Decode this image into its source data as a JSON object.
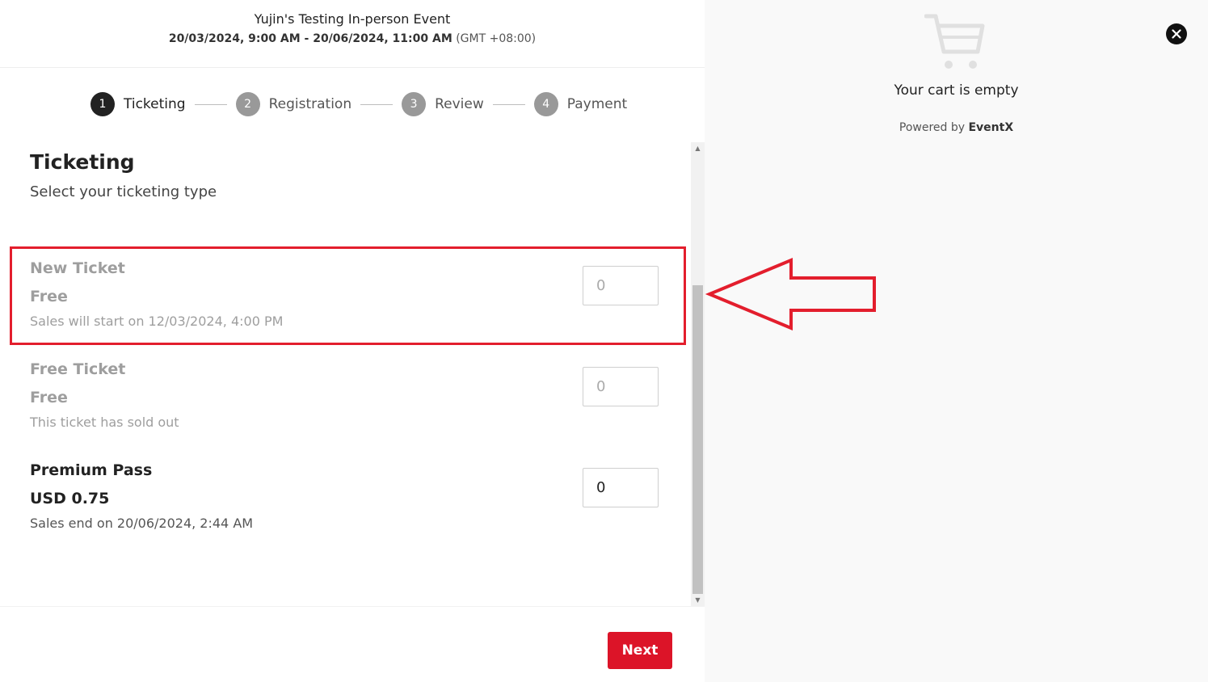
{
  "event": {
    "title": "Yujin's Testing In-person Event",
    "dates": "20/03/2024, 9:00 AM - 20/06/2024, 11:00 AM",
    "timezone": "(GMT +08:00)"
  },
  "steps": [
    {
      "number": "1",
      "label": "Ticketing",
      "active": true
    },
    {
      "number": "2",
      "label": "Registration",
      "active": false
    },
    {
      "number": "3",
      "label": "Review",
      "active": false
    },
    {
      "number": "4",
      "label": "Payment",
      "active": false
    }
  ],
  "ticketing": {
    "title": "Ticketing",
    "subtitle": "Select your ticketing type"
  },
  "tickets": [
    {
      "name": "New Ticket",
      "price": "Free",
      "status": "Sales will start on 12/03/2024, 4:00 PM",
      "quantity_placeholder": "0",
      "disabled": true
    },
    {
      "name": "Free Ticket",
      "price": "Free",
      "status": "This ticket has sold out",
      "quantity_placeholder": "0",
      "disabled": true
    },
    {
      "name": "Premium Pass",
      "price": "USD 0.75",
      "status": "Sales end on 20/06/2024, 2:44 AM",
      "quantity_value": "0",
      "disabled": false
    }
  ],
  "footer": {
    "next_label": "Next"
  },
  "cart": {
    "empty_text": "Your cart is empty",
    "powered_prefix": "Powered by",
    "powered_brand": "EventX"
  },
  "colors": {
    "accent": "#dc1428",
    "annotation": "#e31e2d",
    "active_step": "#222222",
    "inactive_step": "#999999"
  },
  "icons": [
    "cart-icon",
    "close-icon",
    "scroll-up-arrow-icon",
    "scroll-down-arrow-icon",
    "annotation-arrow-icon"
  ]
}
